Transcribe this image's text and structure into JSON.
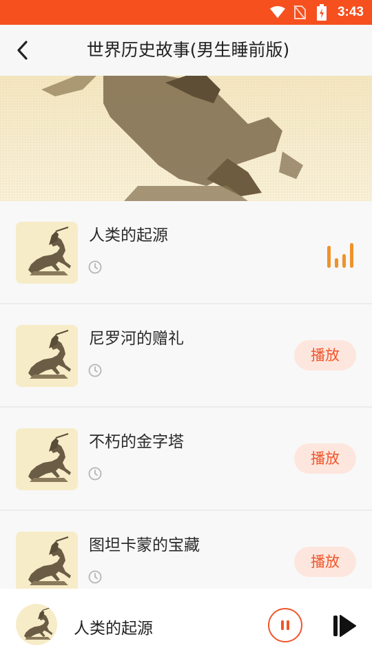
{
  "status_bar": {
    "time": "3:43",
    "icons": [
      "wifi-icon",
      "no-sim-icon",
      "battery-charging-icon"
    ]
  },
  "header": {
    "title": "世界历史故事(男生睡前版)",
    "back_icon": "back-arrow-icon"
  },
  "banner": {
    "image": "horseman-statue-banner"
  },
  "tracks": [
    {
      "title": "人类的起源",
      "state": "playing",
      "duration_icon": "clock-icon"
    },
    {
      "title": "尼罗河的赠礼",
      "action": "播放",
      "duration_icon": "clock-icon"
    },
    {
      "title": "不朽的金字塔",
      "action": "播放",
      "duration_icon": "clock-icon"
    },
    {
      "title": "图坦卡蒙的宝藏",
      "action": "播放",
      "duration_icon": "clock-icon"
    }
  ],
  "player": {
    "now_playing": "人类的起源",
    "pause_icon": "pause-icon",
    "next_icon": "skip-next-icon"
  },
  "colors": {
    "accent": "#f0552a",
    "status_bar": "#f5501e",
    "equalizer": "#f0922a",
    "thumb_bg": "#f7ecc8"
  }
}
